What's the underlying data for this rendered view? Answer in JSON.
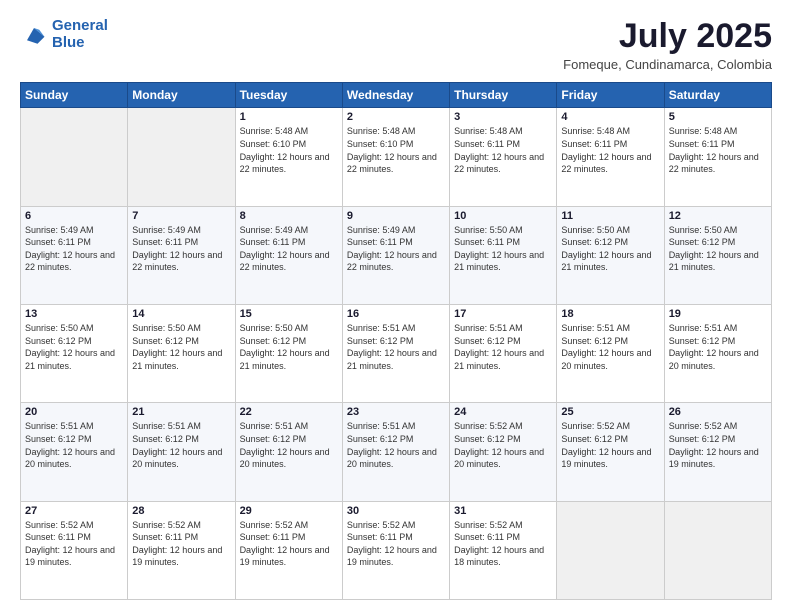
{
  "header": {
    "logo_line1": "General",
    "logo_line2": "Blue",
    "month": "July 2025",
    "location": "Fomeque, Cundinamarca, Colombia"
  },
  "weekdays": [
    "Sunday",
    "Monday",
    "Tuesday",
    "Wednesday",
    "Thursday",
    "Friday",
    "Saturday"
  ],
  "weeks": [
    [
      {
        "day": "",
        "info": ""
      },
      {
        "day": "",
        "info": ""
      },
      {
        "day": "1",
        "info": "Sunrise: 5:48 AM\nSunset: 6:10 PM\nDaylight: 12 hours and 22 minutes."
      },
      {
        "day": "2",
        "info": "Sunrise: 5:48 AM\nSunset: 6:10 PM\nDaylight: 12 hours and 22 minutes."
      },
      {
        "day": "3",
        "info": "Sunrise: 5:48 AM\nSunset: 6:11 PM\nDaylight: 12 hours and 22 minutes."
      },
      {
        "day": "4",
        "info": "Sunrise: 5:48 AM\nSunset: 6:11 PM\nDaylight: 12 hours and 22 minutes."
      },
      {
        "day": "5",
        "info": "Sunrise: 5:48 AM\nSunset: 6:11 PM\nDaylight: 12 hours and 22 minutes."
      }
    ],
    [
      {
        "day": "6",
        "info": "Sunrise: 5:49 AM\nSunset: 6:11 PM\nDaylight: 12 hours and 22 minutes."
      },
      {
        "day": "7",
        "info": "Sunrise: 5:49 AM\nSunset: 6:11 PM\nDaylight: 12 hours and 22 minutes."
      },
      {
        "day": "8",
        "info": "Sunrise: 5:49 AM\nSunset: 6:11 PM\nDaylight: 12 hours and 22 minutes."
      },
      {
        "day": "9",
        "info": "Sunrise: 5:49 AM\nSunset: 6:11 PM\nDaylight: 12 hours and 22 minutes."
      },
      {
        "day": "10",
        "info": "Sunrise: 5:50 AM\nSunset: 6:11 PM\nDaylight: 12 hours and 21 minutes."
      },
      {
        "day": "11",
        "info": "Sunrise: 5:50 AM\nSunset: 6:12 PM\nDaylight: 12 hours and 21 minutes."
      },
      {
        "day": "12",
        "info": "Sunrise: 5:50 AM\nSunset: 6:12 PM\nDaylight: 12 hours and 21 minutes."
      }
    ],
    [
      {
        "day": "13",
        "info": "Sunrise: 5:50 AM\nSunset: 6:12 PM\nDaylight: 12 hours and 21 minutes."
      },
      {
        "day": "14",
        "info": "Sunrise: 5:50 AM\nSunset: 6:12 PM\nDaylight: 12 hours and 21 minutes."
      },
      {
        "day": "15",
        "info": "Sunrise: 5:50 AM\nSunset: 6:12 PM\nDaylight: 12 hours and 21 minutes."
      },
      {
        "day": "16",
        "info": "Sunrise: 5:51 AM\nSunset: 6:12 PM\nDaylight: 12 hours and 21 minutes."
      },
      {
        "day": "17",
        "info": "Sunrise: 5:51 AM\nSunset: 6:12 PM\nDaylight: 12 hours and 21 minutes."
      },
      {
        "day": "18",
        "info": "Sunrise: 5:51 AM\nSunset: 6:12 PM\nDaylight: 12 hours and 20 minutes."
      },
      {
        "day": "19",
        "info": "Sunrise: 5:51 AM\nSunset: 6:12 PM\nDaylight: 12 hours and 20 minutes."
      }
    ],
    [
      {
        "day": "20",
        "info": "Sunrise: 5:51 AM\nSunset: 6:12 PM\nDaylight: 12 hours and 20 minutes."
      },
      {
        "day": "21",
        "info": "Sunrise: 5:51 AM\nSunset: 6:12 PM\nDaylight: 12 hours and 20 minutes."
      },
      {
        "day": "22",
        "info": "Sunrise: 5:51 AM\nSunset: 6:12 PM\nDaylight: 12 hours and 20 minutes."
      },
      {
        "day": "23",
        "info": "Sunrise: 5:51 AM\nSunset: 6:12 PM\nDaylight: 12 hours and 20 minutes."
      },
      {
        "day": "24",
        "info": "Sunrise: 5:52 AM\nSunset: 6:12 PM\nDaylight: 12 hours and 20 minutes."
      },
      {
        "day": "25",
        "info": "Sunrise: 5:52 AM\nSunset: 6:12 PM\nDaylight: 12 hours and 19 minutes."
      },
      {
        "day": "26",
        "info": "Sunrise: 5:52 AM\nSunset: 6:12 PM\nDaylight: 12 hours and 19 minutes."
      }
    ],
    [
      {
        "day": "27",
        "info": "Sunrise: 5:52 AM\nSunset: 6:11 PM\nDaylight: 12 hours and 19 minutes."
      },
      {
        "day": "28",
        "info": "Sunrise: 5:52 AM\nSunset: 6:11 PM\nDaylight: 12 hours and 19 minutes."
      },
      {
        "day": "29",
        "info": "Sunrise: 5:52 AM\nSunset: 6:11 PM\nDaylight: 12 hours and 19 minutes."
      },
      {
        "day": "30",
        "info": "Sunrise: 5:52 AM\nSunset: 6:11 PM\nDaylight: 12 hours and 19 minutes."
      },
      {
        "day": "31",
        "info": "Sunrise: 5:52 AM\nSunset: 6:11 PM\nDaylight: 12 hours and 18 minutes."
      },
      {
        "day": "",
        "info": ""
      },
      {
        "day": "",
        "info": ""
      }
    ]
  ]
}
